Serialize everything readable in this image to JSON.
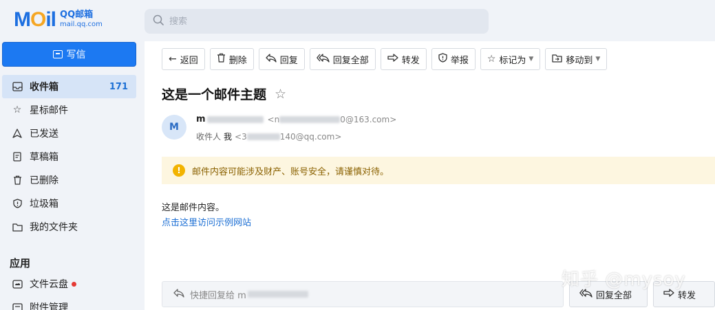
{
  "logo": {
    "mark": "MOil",
    "brand": "QQ邮箱",
    "domain": "mail.qq.com"
  },
  "search": {
    "placeholder": "搜索"
  },
  "compose_label": "写信",
  "nav": [
    {
      "label": "收件箱",
      "count": "171"
    },
    {
      "label": "星标邮件"
    },
    {
      "label": "已发送"
    },
    {
      "label": "草稿箱"
    },
    {
      "label": "已删除"
    },
    {
      "label": "垃圾箱"
    },
    {
      "label": "我的文件夹"
    }
  ],
  "apps": {
    "title": "应用",
    "items": [
      {
        "label": "文件云盘"
      },
      {
        "label": "附件管理"
      }
    ]
  },
  "toolbar": {
    "back": "返回",
    "delete": "删除",
    "reply": "回复",
    "reply_all": "回复全部",
    "forward": "转发",
    "report": "举报",
    "mark_as": "标记为",
    "move_to": "移动到"
  },
  "mail": {
    "subject": "这是一个邮件主题",
    "avatar_letter": "M",
    "sender_name_prefix": "m",
    "sender_addr_prefix": "<n",
    "sender_addr_suffix": "0@163.com>",
    "recipient_label": "收件人",
    "recipient_name": "我",
    "recipient_addr_prefix": "<3",
    "recipient_addr_suffix": "140@qq.com>",
    "warning": "邮件内容可能涉及财产、账号安全，请谨慎对待。",
    "body": "这是邮件内容。",
    "link": "点击这里访问示例网站"
  },
  "quick_reply": {
    "placeholder_prefix": "快捷回复给 m",
    "reply_all": "回复全部",
    "forward": "转发"
  },
  "watermark": "知乎 @mysoy",
  "colors": {
    "accent": "#1c79f2",
    "link": "#1c6fd4",
    "warning_bg": "#fdf6e0",
    "warning_icon": "#f2b300"
  }
}
